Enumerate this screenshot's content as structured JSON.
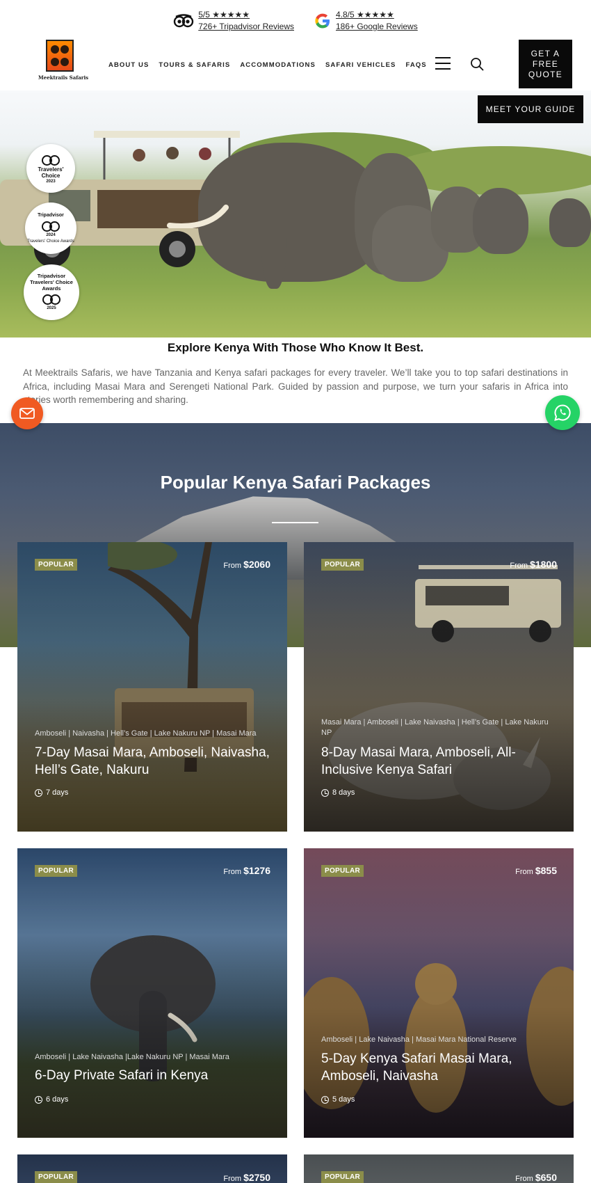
{
  "reviews": {
    "tripadvisor": {
      "score": "5/5 ★★★★★",
      "count": "726+ Tripadvisor Reviews"
    },
    "google": {
      "score": "4.8/5 ★★★★★",
      "count": "186+ Google Reviews"
    }
  },
  "logo": {
    "text": "Meektrails Safaris"
  },
  "nav": {
    "items": [
      {
        "label": "About Us"
      },
      {
        "label": "Tours & Safaris"
      },
      {
        "label": "Accommodations"
      },
      {
        "label": "Safari Vehicles"
      },
      {
        "label": "FAQs"
      }
    ],
    "quote_label": "Get a Free Quote",
    "guide_label": "Meet Your Guide"
  },
  "hero": {
    "badges": [
      {
        "line1": "Travelers'",
        "line2": "Choice",
        "year": "2023"
      },
      {
        "line1": "Tripadvisor",
        "line2": "Travelers' Choice Awards",
        "year": "2024"
      },
      {
        "line1": "Tripadvisor Travelers' Choice Awards",
        "line2": "",
        "year": "2025"
      }
    ]
  },
  "intro": {
    "title": "Explore Kenya With Those Who Know It Best.",
    "text": "At Meektrails Safaris, we have Tanzania and Kenya safari packages for every traveler. We’ll take you to top safari destinations in Africa, including Masai Mara and Serengeti National Park. Guided by passion and purpose, we turn your safaris in Africa into stories worth remembering and sharing."
  },
  "packages": {
    "title": "Popular Kenya Safari Packages",
    "from_label": "From",
    "cards": [
      {
        "tag": "Popular",
        "price": "$2060",
        "route": "Amboseli | Naivasha | Hell’s Gate | Lake Nakuru NP | Masai Mara",
        "name": "7-Day Masai Mara, Amboseli, Naivasha, Hell’s Gate, Nakuru",
        "days": "7 days"
      },
      {
        "tag": "Popular",
        "price": "$1800",
        "route": "Masai Mara | Amboseli | Lake Naivasha | Hell’s Gate | Lake Nakuru NP",
        "name": "8-Day Masai Mara, Amboseli, All-Inclusive Kenya Safari",
        "days": "8 days"
      },
      {
        "tag": "Popular",
        "price": "$1276",
        "route": "Amboseli | Lake Naivasha |Lake Nakuru NP | Masai Mara",
        "name": "6-Day Private Safari in Kenya",
        "days": "6 days"
      },
      {
        "tag": "Popular",
        "price": "$855",
        "route": "Amboseli | Lake Naivasha | Masai Mara National Reserve",
        "name": "5-Day Kenya Safari Masai Mara, Amboseli, Naivasha",
        "days": "5 days"
      },
      {
        "tag": "Popular",
        "price": "$2750"
      },
      {
        "tag": "Popular",
        "price": "$650"
      }
    ]
  },
  "colors": {
    "accent_orange": "#f05a22",
    "whatsapp_green": "#25d366",
    "tag_olive": "#8b8d4a",
    "button_black": "#0a0a0a"
  }
}
